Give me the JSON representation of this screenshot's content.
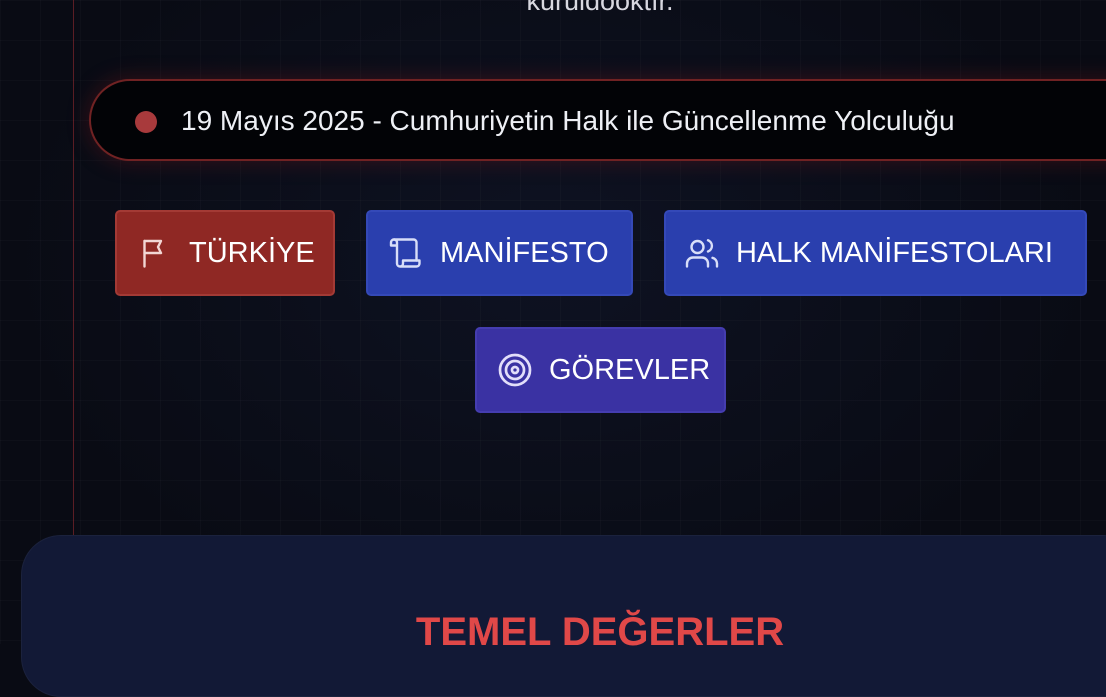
{
  "hero": {
    "subtitle_fragment": "kuruldooktır."
  },
  "date_banner": {
    "text": "19 Mayıs 2025 - Cumhuriyetin Halk ile Güncellenme Yolculuğu",
    "dot_color": "#a83a3c"
  },
  "nav": {
    "buttons": [
      {
        "label": "TÜRKİYE",
        "icon": "flag-icon",
        "color": "#8f2824"
      },
      {
        "label": "MANİFESTO",
        "icon": "scroll-icon",
        "color": "#2a3fae"
      },
      {
        "label": "HALK MANİFESTOLARI",
        "icon": "users-icon",
        "color": "#2a3fae"
      },
      {
        "label": "GÖREVLER",
        "icon": "target-icon",
        "color": "#3a32a3"
      }
    ]
  },
  "values_section": {
    "title": "TEMEL DEĞERLER",
    "title_color": "#e04848"
  }
}
